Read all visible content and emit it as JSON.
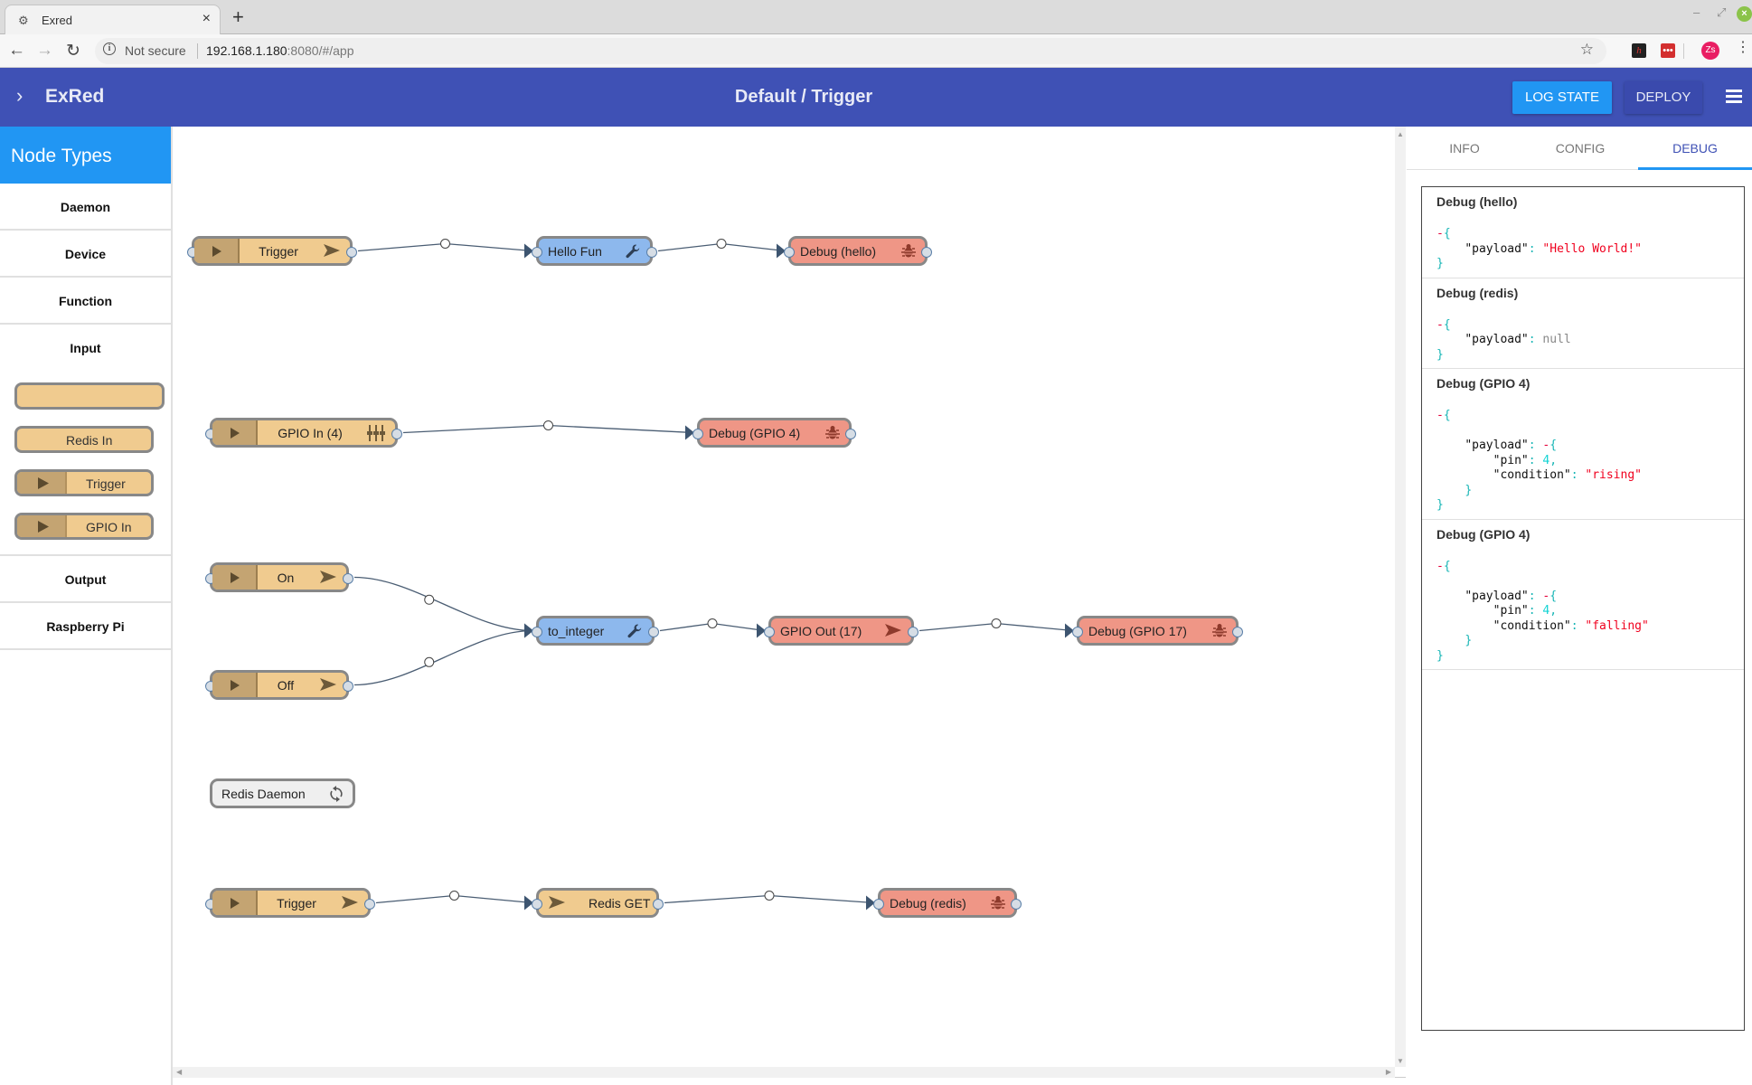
{
  "browser": {
    "tab_title": "Exred",
    "new_tab": "+",
    "security_label": "Not secure",
    "url_host": "192.168.1.180",
    "url_rest": ":8080/#/app",
    "avatar_initials": "Zs"
  },
  "header": {
    "brand": "ExRed",
    "breadcrumb": "Default / Trigger",
    "log_state_label": "LOG STATE",
    "deploy_label": "DEPLOY"
  },
  "sidebar": {
    "title": "Node Types",
    "categories": [
      "Daemon",
      "Device",
      "Function",
      "Input",
      "Output",
      "Raspberry Pi"
    ],
    "input_palette": [
      {
        "label": "",
        "kind": "send"
      },
      {
        "label": "Redis In",
        "kind": "send"
      },
      {
        "label": "Trigger",
        "kind": "button"
      },
      {
        "label": "GPIO In",
        "kind": "button"
      }
    ]
  },
  "flow": {
    "nodes": [
      {
        "id": "trigger1",
        "label": "Trigger",
        "type": "input",
        "has_button": true,
        "icon": "send-icon"
      },
      {
        "id": "hello_fun",
        "label": "Hello Fun",
        "type": "function",
        "icon": "wrench-icon"
      },
      {
        "id": "debug_hello",
        "label": "Debug (hello)",
        "type": "output",
        "icon": "bug-icon"
      },
      {
        "id": "gpio_in4",
        "label": "GPIO In (4)",
        "type": "input",
        "has_button": true,
        "icon": "sliders-icon"
      },
      {
        "id": "debug_gpio4",
        "label": "Debug (GPIO 4)",
        "type": "output",
        "icon": "bug-icon"
      },
      {
        "id": "on",
        "label": "On",
        "type": "input",
        "has_button": true,
        "icon": "send-icon"
      },
      {
        "id": "off",
        "label": "Off",
        "type": "input",
        "has_button": true,
        "icon": "send-icon"
      },
      {
        "id": "to_integer",
        "label": "to_integer",
        "type": "function",
        "icon": "wrench-icon"
      },
      {
        "id": "gpio_out17",
        "label": "GPIO Out (17)",
        "type": "output",
        "icon": "send-icon"
      },
      {
        "id": "debug_gpio17",
        "label": "Debug (GPIO 17)",
        "type": "output",
        "icon": "bug-icon"
      },
      {
        "id": "redis_daemon",
        "label": "Redis Daemon",
        "type": "daemon",
        "icon": "refresh-icon"
      },
      {
        "id": "trigger2",
        "label": "Trigger",
        "type": "input",
        "has_button": true,
        "icon": "send-icon"
      },
      {
        "id": "redis_get",
        "label": "Redis GET",
        "type": "input",
        "icon": "send-icon"
      },
      {
        "id": "debug_redis",
        "label": "Debug (redis)",
        "type": "output",
        "icon": "bug-icon"
      }
    ],
    "links": [
      [
        "trigger1",
        "hello_fun"
      ],
      [
        "hello_fun",
        "debug_hello"
      ],
      [
        "gpio_in4",
        "debug_gpio4"
      ],
      [
        "on",
        "to_integer"
      ],
      [
        "off",
        "to_integer"
      ],
      [
        "to_integer",
        "gpio_out17"
      ],
      [
        "gpio_out17",
        "debug_gpio17"
      ],
      [
        "trigger2",
        "redis_get"
      ],
      [
        "redis_get",
        "debug_redis"
      ]
    ]
  },
  "right_panel": {
    "tabs": [
      "INFO",
      "CONFIG",
      "DEBUG"
    ],
    "active_tab": "DEBUG",
    "debug_entries": [
      {
        "title": "Debug (hello)",
        "payload": "\"Hello World!\"",
        "payload_type": "string"
      },
      {
        "title": "Debug (redis)",
        "payload": "null",
        "payload_type": "null"
      },
      {
        "title": "Debug (GPIO 4)",
        "payload_type": "object",
        "pin": "4",
        "condition": "\"rising\""
      },
      {
        "title": "Debug (GPIO 4)",
        "payload_type": "object",
        "pin": "4",
        "condition": "\"falling\""
      }
    ],
    "key_payload": "\"payload\"",
    "key_pin": "\"pin\"",
    "key_condition": "\"condition\""
  },
  "colors": {
    "appbar": "#3f51b5",
    "accent": "#2196f3",
    "input_node": "#f0cb8f",
    "function_node": "#8db8ed",
    "output_node": "#ef9686",
    "daemon_node": "#efefef"
  }
}
